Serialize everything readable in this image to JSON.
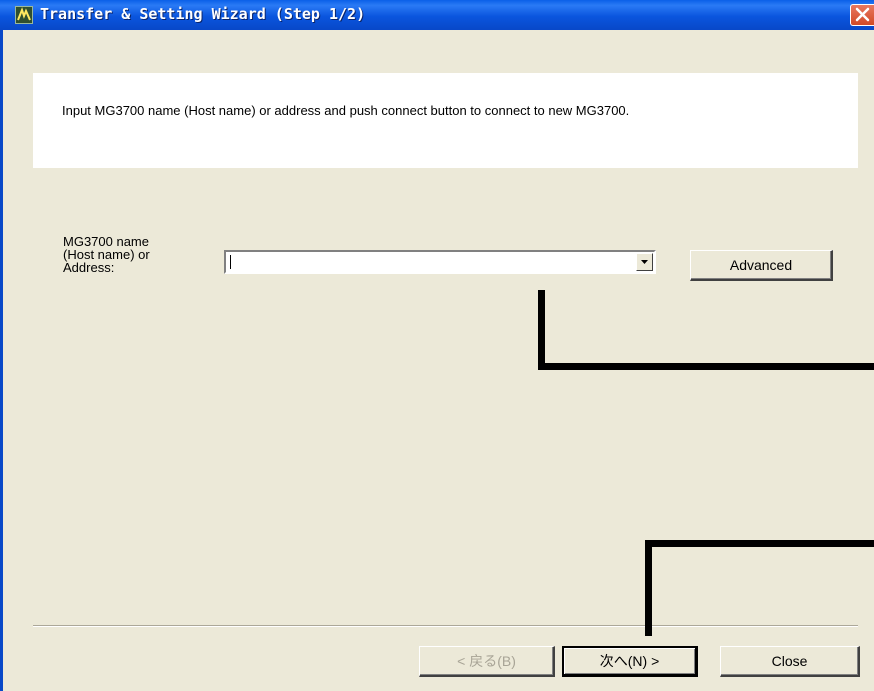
{
  "window": {
    "title": "Transfer & Setting Wizard (Step 1/2)",
    "app_icon": "wizard-app-icon",
    "close_icon": "close-icon"
  },
  "instructions": {
    "text": "Input MG3700 name (Host name) or address and push connect button to connect to new MG3700."
  },
  "host_field": {
    "label_line1": "MG3700 name",
    "label_line2": "(Host name) or",
    "label_line3": "Address:",
    "value": "",
    "dropdown_icon": "chevron-down-icon"
  },
  "buttons": {
    "advanced": "Advanced",
    "back": "< 戻る(B)",
    "next": "次へ(N) >",
    "close": "Close"
  },
  "colors": {
    "titlebar": "#0a55de",
    "dialog_bg": "#ece9d8",
    "close_button": "#d24a26",
    "callout_lines": "#000000"
  }
}
